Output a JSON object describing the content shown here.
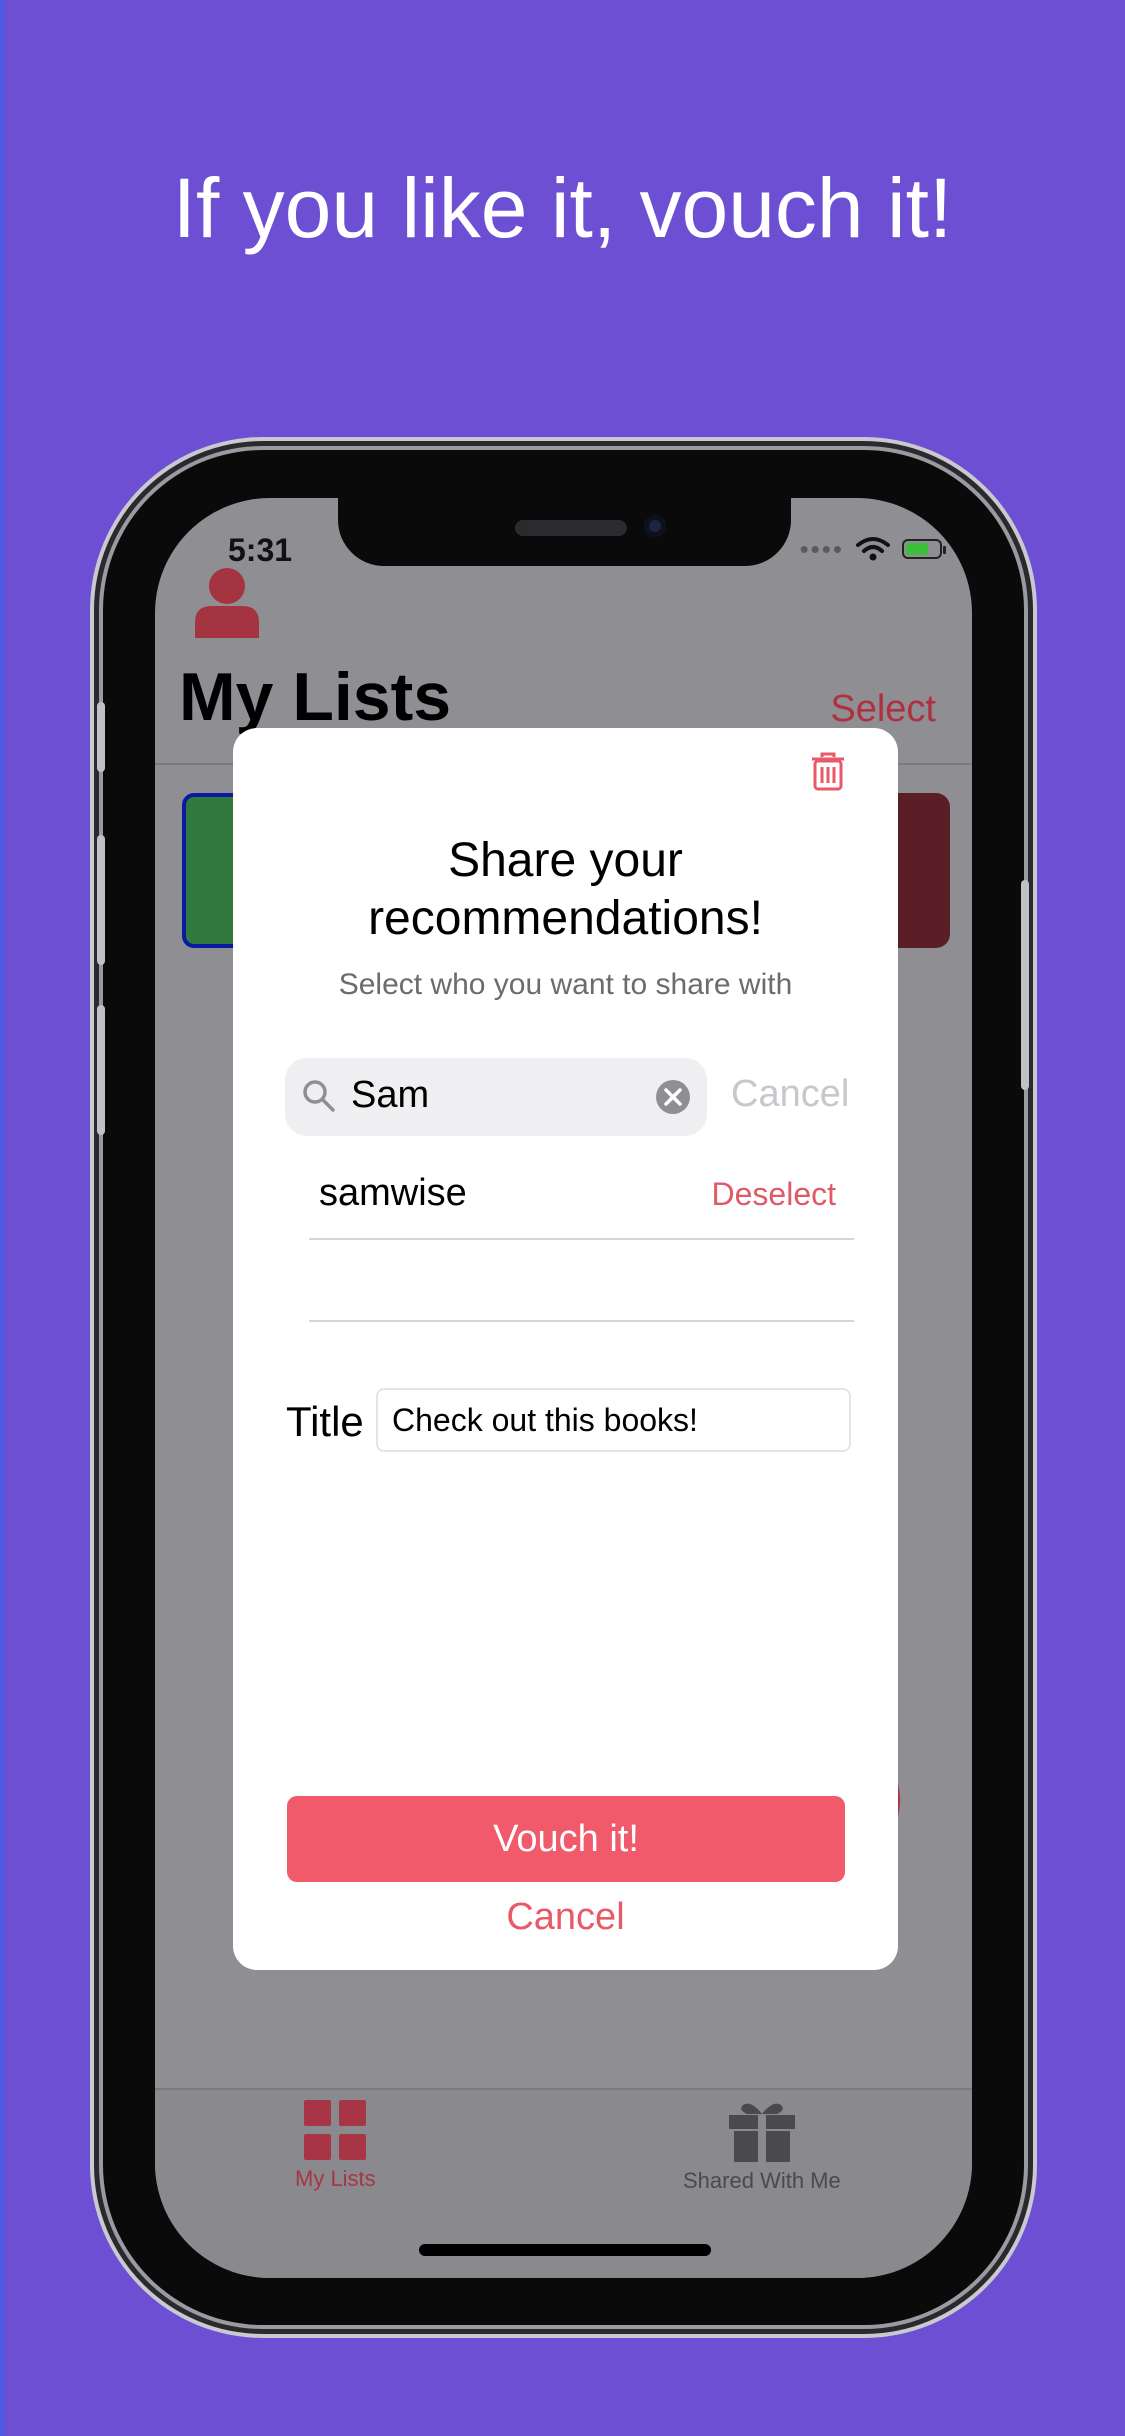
{
  "headline": "If you like it, vouch it!",
  "status_bar": {
    "time": "5:31",
    "signal": "••••"
  },
  "nav": {
    "title": "My Lists",
    "select_label": "Select"
  },
  "modal": {
    "title_line1": "Share your",
    "title_line2": "recommendations!",
    "subtitle": "Select who you want to share with",
    "search": {
      "value": "Sam",
      "cancel_label": "Cancel"
    },
    "results": [
      {
        "name": "samwise",
        "action": "Deselect"
      }
    ],
    "title_label": "Title",
    "title_value": "Check out this books!",
    "vouch_label": "Vouch it!",
    "cancel_label": "Cancel"
  },
  "tabbar": {
    "items": [
      {
        "label": "My Lists",
        "selected": true
      },
      {
        "label": "Shared With Me",
        "selected": false
      }
    ]
  },
  "colors": {
    "background": "#6d4fd3",
    "accent": "#f15a6b",
    "dim_overlay": "#8e8e93"
  }
}
